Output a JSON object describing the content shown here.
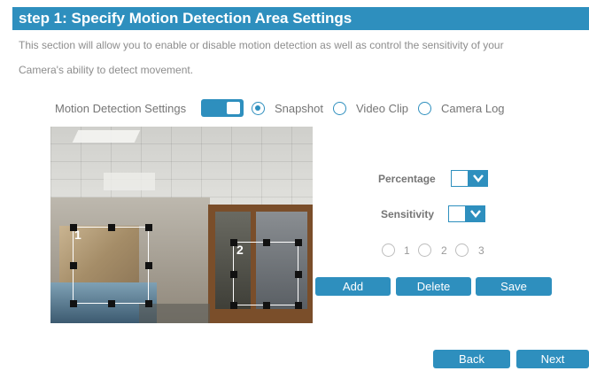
{
  "header": {
    "title": "step 1: Specify Motion Detection Area Settings"
  },
  "description": {
    "line1": "This section will allow you to enable or disable motion detection as well as control the sensitivity of your",
    "line2": "Camera's ability to detect movement."
  },
  "settings": {
    "label": "Motion Detection Settings",
    "toggle_on": true,
    "modes": [
      {
        "label": "Snapshot",
        "checked": true
      },
      {
        "label": "Video Clip",
        "checked": false
      },
      {
        "label": "Camera Log",
        "checked": false
      }
    ]
  },
  "zones": [
    {
      "number": "1"
    },
    {
      "number": "2"
    }
  ],
  "panel": {
    "percentage_label": "Percentage",
    "sensitivity_label": "Sensitivity",
    "zone_options": [
      "1",
      "2",
      "3"
    ]
  },
  "buttons": {
    "add": "Add",
    "delete": "Delete",
    "save": "Save",
    "back": "Back",
    "next": "Next"
  },
  "colors": {
    "accent": "#2e8fbe",
    "text_gray": "#757575"
  }
}
